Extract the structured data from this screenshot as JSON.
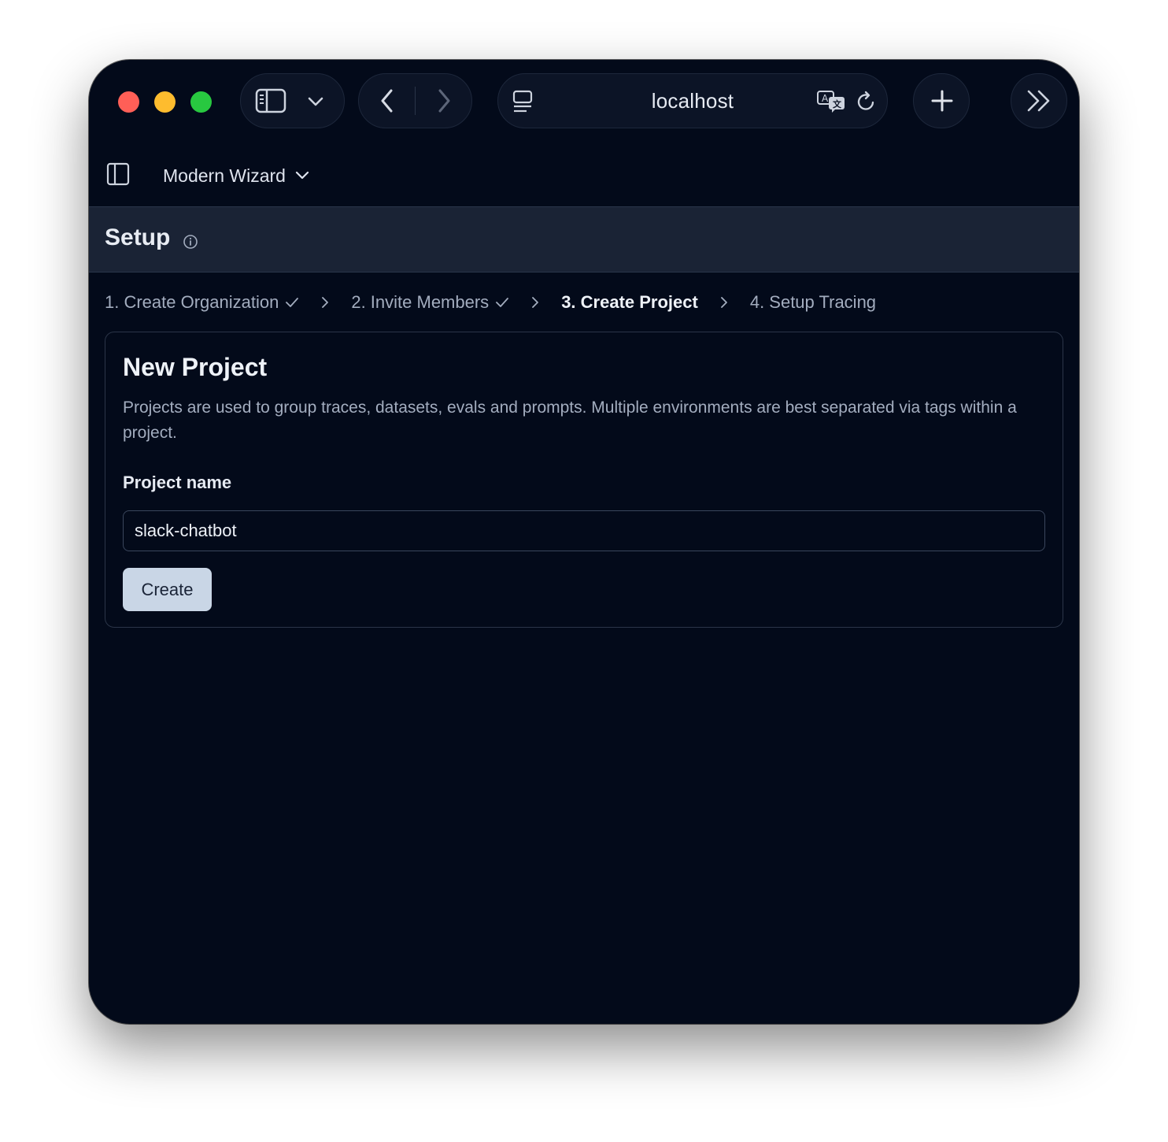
{
  "browser": {
    "url": "localhost",
    "traffic_lights": {
      "close": "#ff5f57",
      "minimize": "#febc2e",
      "zoom": "#28c840"
    }
  },
  "app": {
    "workspace_name": "Modern Wizard",
    "page_title": "Setup"
  },
  "steps": [
    {
      "label": "1. Create Organization",
      "status": "completed"
    },
    {
      "label": "2. Invite Members",
      "status": "completed"
    },
    {
      "label": "3. Create Project",
      "status": "active"
    },
    {
      "label": "4. Setup Tracing",
      "status": "pending"
    }
  ],
  "card": {
    "title": "New Project",
    "description": "Projects are used to group traces, datasets, evals and prompts. Multiple environments are best separated via tags within a project.",
    "field_label": "Project name",
    "field_value": "slack-chatbot",
    "submit_label": "Create"
  },
  "colors": {
    "background": "#030a1a",
    "header_bar": "#1a2335",
    "primary_button": "#c9d6e6"
  },
  "icons": [
    "sidebar-icon",
    "chevron-down-icon",
    "back-icon",
    "forward-icon",
    "page-icon",
    "translate-icon",
    "reload-icon",
    "plus-icon",
    "double-chevron-right-icon",
    "info-icon",
    "check-icon",
    "chevron-right-icon"
  ]
}
